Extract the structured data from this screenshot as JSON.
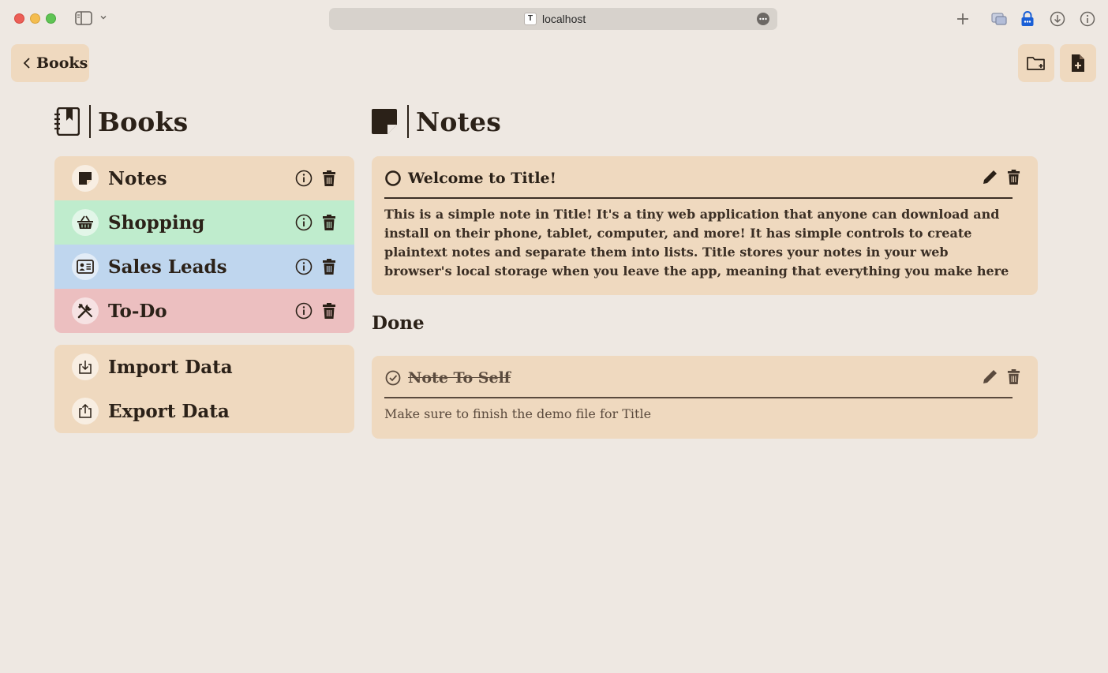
{
  "browser": {
    "url": "localhost",
    "favicon_letter": "T"
  },
  "nav": {
    "back_label": "Books"
  },
  "books_section": {
    "title": "Books",
    "items": [
      {
        "label": "Notes",
        "color": "#efd9bf",
        "icon": "sticky-note-icon"
      },
      {
        "label": "Shopping",
        "color": "#bfeccd",
        "icon": "basket-icon"
      },
      {
        "label": "Sales Leads",
        "color": "#bfd6ee",
        "icon": "contact-card-icon"
      },
      {
        "label": "To-Do",
        "color": "#ecbfc0",
        "icon": "tools-icon"
      }
    ],
    "data_actions": [
      {
        "label": "Import Data",
        "icon": "import-icon"
      },
      {
        "label": "Export Data",
        "icon": "export-icon"
      }
    ]
  },
  "notes_section": {
    "title": "Notes",
    "notes": [
      {
        "title": "Welcome to Title!",
        "done": false,
        "body": "This is a simple note in Title! It's a tiny web application that anyone can download and install on their phone, tablet, computer, and more! It has simple controls to create plaintext notes and separate them into lists. Title stores your notes in your web browser's local storage when you leave the app, meaning that everything you make here stays on the device you're using and is never shared with third parties or…"
      }
    ],
    "done_heading": "Done",
    "done_notes": [
      {
        "title": "Note To Self",
        "done": true,
        "body": "Make sure to finish the demo file for Title"
      }
    ]
  },
  "colors": {
    "background": "#eee8e2",
    "card": "#efd9bf",
    "text": "#2b2118",
    "lock_blue": "#1a5fd6"
  }
}
